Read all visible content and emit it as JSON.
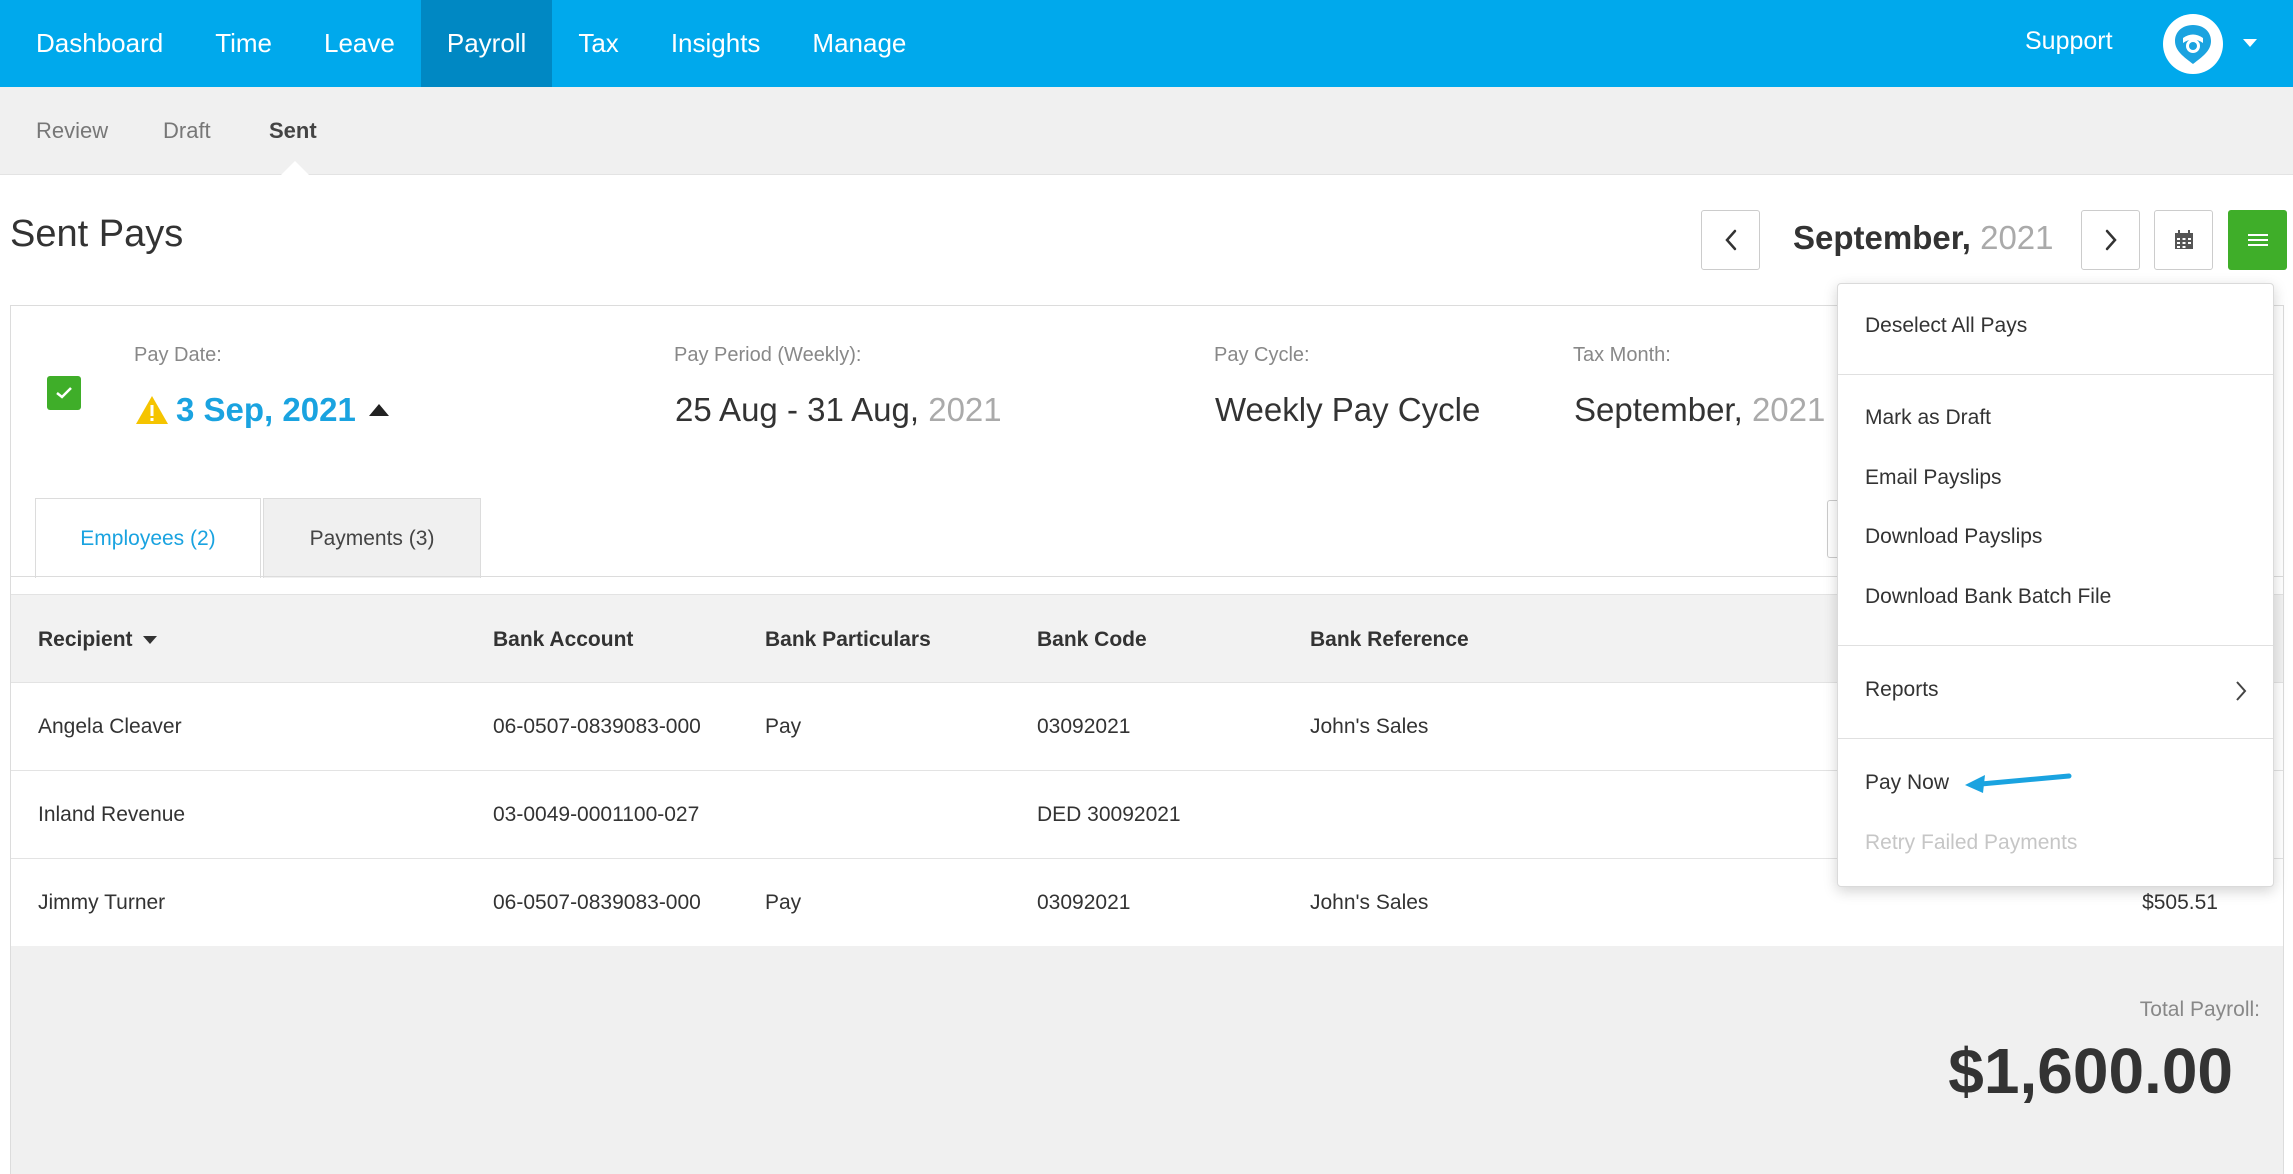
{
  "topnav": {
    "items": [
      "Dashboard",
      "Time",
      "Leave",
      "Payroll",
      "Tax",
      "Insights",
      "Manage"
    ],
    "active": "Payroll",
    "support": "Support",
    "avatar_icon": "logo-icon",
    "colors": {
      "bar": "#00a9ec",
      "active": "#0088c3"
    }
  },
  "subnav": {
    "items": [
      "Review",
      "Draft",
      "Sent"
    ],
    "active": "Sent"
  },
  "header": {
    "title": "Sent Pays",
    "month": "September,",
    "year": "2021"
  },
  "pay": {
    "checked": true,
    "pay_date_label": "Pay Date:",
    "pay_date_value": "3 Sep, 2021",
    "pay_period_label": "Pay Period (Weekly):",
    "pay_period_value": "25 Aug - 31 Aug,",
    "pay_period_year": "2021",
    "pay_cycle_label": "Pay Cycle:",
    "pay_cycle_value": "Weekly Pay Cycle",
    "tax_month_label": "Tax Month:",
    "tax_month_value": "September,",
    "tax_month_year": "2021"
  },
  "tabs": {
    "employees": "Employees (2)",
    "payments": "Payments (3)",
    "active": "employees"
  },
  "table": {
    "headers": [
      "Recipient",
      "Bank Account",
      "Bank Particulars",
      "Bank Code",
      "Bank Reference"
    ],
    "rows": [
      {
        "recipient": "Angela Cleaver",
        "account": "06-0507-0839083-000",
        "particulars": "Pay",
        "code": "03092021",
        "reference": "John's Sales",
        "amount": ""
      },
      {
        "recipient": "Inland Revenue",
        "account": "03-0049-0001100-027",
        "particulars": "",
        "code": "DED 30092021",
        "reference": "",
        "amount": ""
      },
      {
        "recipient": "Jimmy Turner",
        "account": "06-0507-0839083-000",
        "particulars": "Pay",
        "code": "03092021",
        "reference": "John's Sales",
        "amount": "$505.51"
      }
    ]
  },
  "totals": {
    "label": "Total Payroll:",
    "value": "$1,600.00"
  },
  "dropdown": {
    "items": {
      "deselect": "Deselect All Pays",
      "mark_draft": "Mark as Draft",
      "email": "Email Payslips",
      "download_payslips": "Download Payslips",
      "download_batch": "Download Bank Batch File",
      "reports": "Reports",
      "pay_now": "Pay Now",
      "retry": "Retry Failed Payments"
    },
    "retry_disabled": true
  },
  "colors": {
    "accent_blue": "#1aa3e0",
    "green": "#3fae29",
    "warning": "#f5c400",
    "annotation_arrow": "#1aa3e0"
  }
}
